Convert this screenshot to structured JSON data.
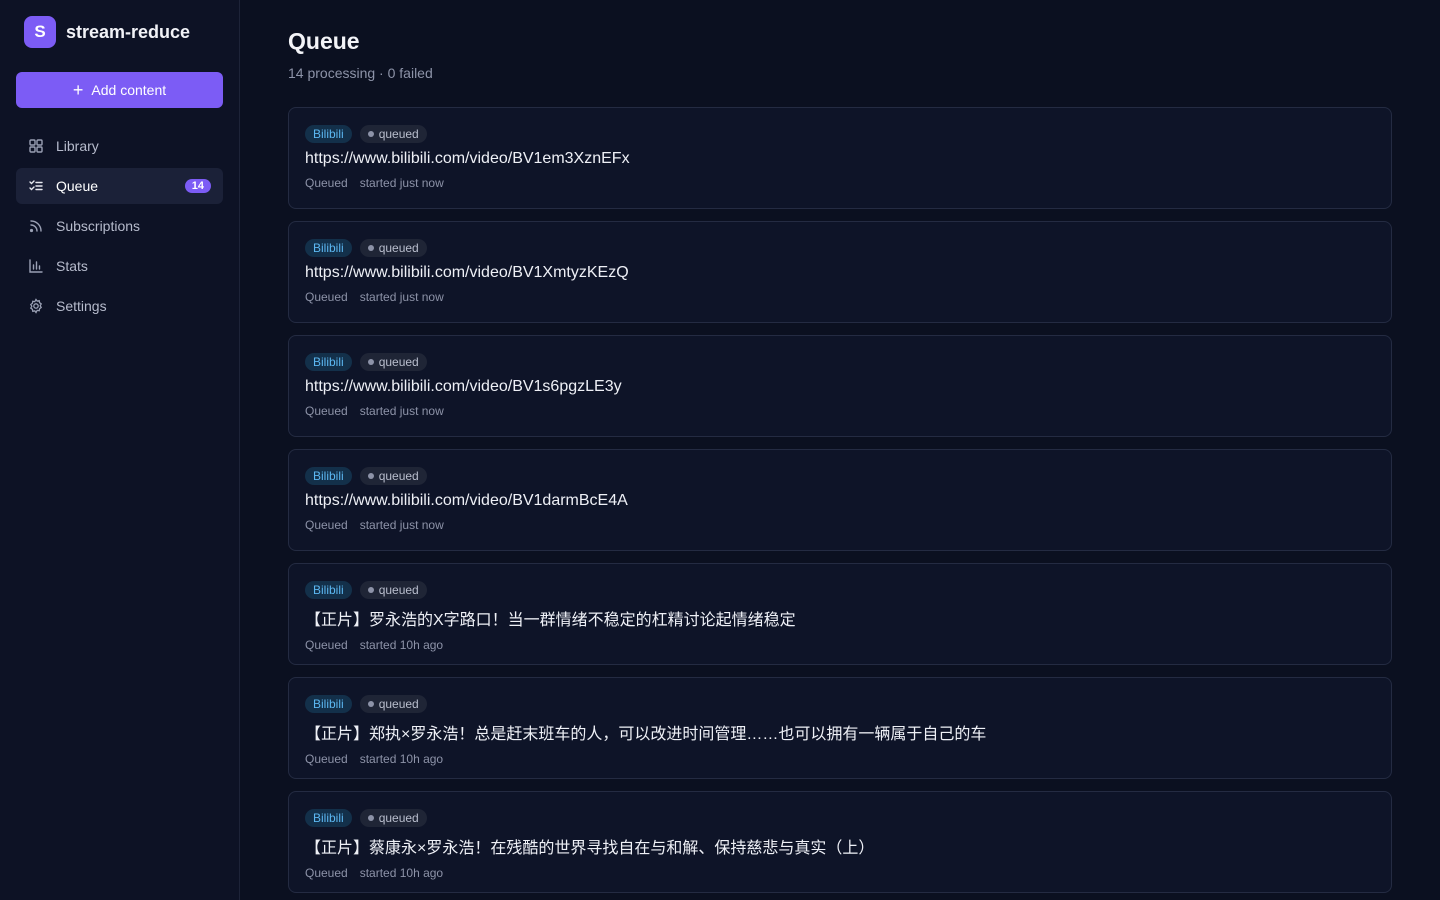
{
  "brand": {
    "logo_letter": "S",
    "name": "stream-reduce"
  },
  "sidebar": {
    "add_button": "Add content",
    "items": [
      {
        "label": "Library",
        "icon": "grid-icon",
        "active": false
      },
      {
        "label": "Queue",
        "icon": "checklist-icon",
        "active": true,
        "count": "14"
      },
      {
        "label": "Subscriptions",
        "icon": "rss-icon",
        "active": false
      },
      {
        "label": "Stats",
        "icon": "bar-chart-icon",
        "active": false
      },
      {
        "label": "Settings",
        "icon": "gear-icon",
        "active": false
      }
    ]
  },
  "page": {
    "title": "Queue",
    "subtitle": "14 processing · 0 failed"
  },
  "queue": [
    {
      "source": "Bilibili",
      "status": "queued",
      "title": "https://www.bilibili.com/video/BV1em3XznEFx",
      "state": "Queued",
      "started": "started just now"
    },
    {
      "source": "Bilibili",
      "status": "queued",
      "title": "https://www.bilibili.com/video/BV1XmtyzKEzQ",
      "state": "Queued",
      "started": "started just now"
    },
    {
      "source": "Bilibili",
      "status": "queued",
      "title": "https://www.bilibili.com/video/BV1s6pgzLE3y",
      "state": "Queued",
      "started": "started just now"
    },
    {
      "source": "Bilibili",
      "status": "queued",
      "title": "https://www.bilibili.com/video/BV1darmBcE4A",
      "state": "Queued",
      "started": "started just now"
    },
    {
      "source": "Bilibili",
      "status": "queued",
      "title": "【正片】罗永浩的X字路口！当一群情绪不稳定的杠精讨论起情绪稳定",
      "state": "Queued",
      "started": "started 10h ago"
    },
    {
      "source": "Bilibili",
      "status": "queued",
      "title": "【正片】郑执×罗永浩！总是赶末班车的人，可以改进时间管理……也可以拥有一辆属于自己的车",
      "state": "Queued",
      "started": "started 10h ago"
    },
    {
      "source": "Bilibili",
      "status": "queued",
      "title": "【正片】蔡康永×罗永浩！在残酷的世界寻找自在与和解、保持慈悲与真实（上）",
      "state": "Queued",
      "started": "started 10h ago"
    }
  ],
  "colors": {
    "accent": "#7c5cf5",
    "background": "#0b1020",
    "source_tag": "#5cb8f2"
  }
}
